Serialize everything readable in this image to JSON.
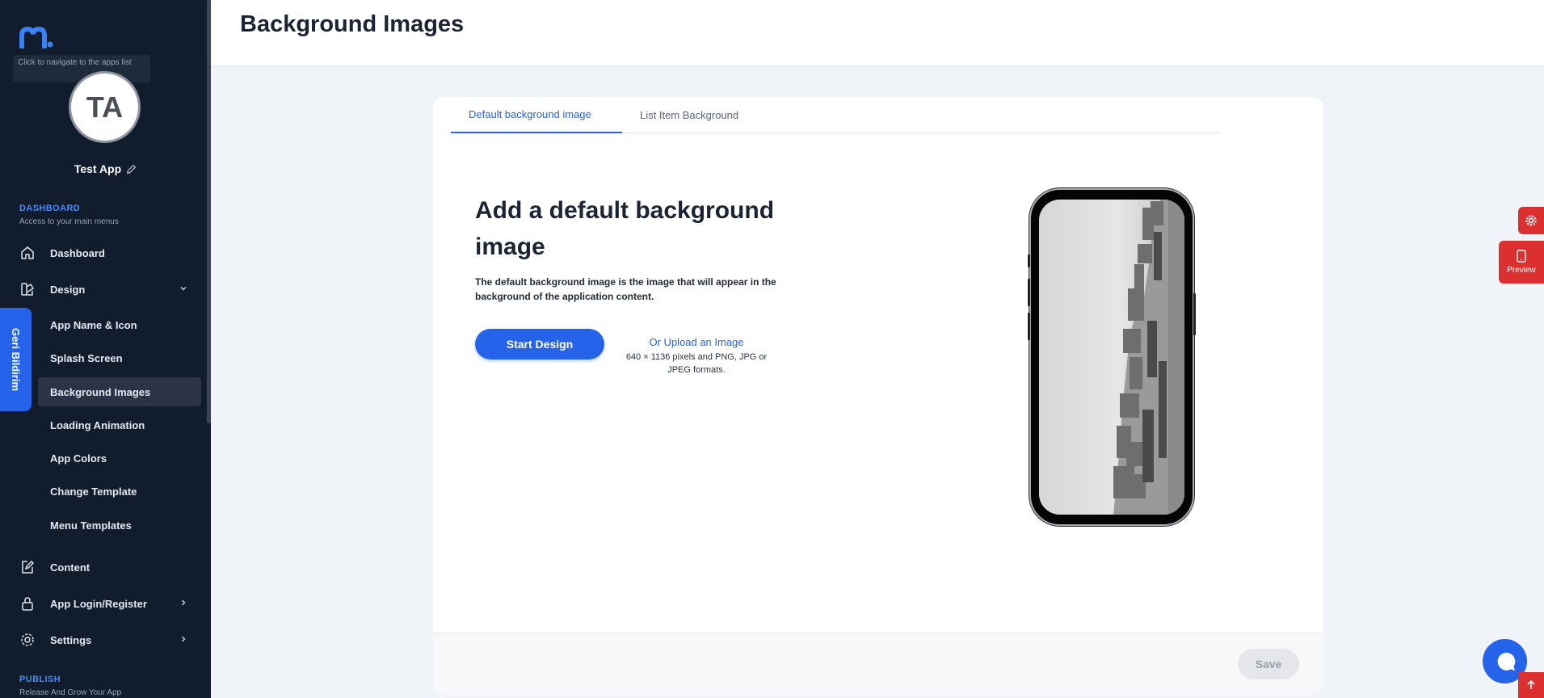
{
  "sidebar": {
    "tooltip": "Click to navigate to the apps list",
    "avatar_initials": "TA",
    "app_name": "Test App",
    "dashboard_section": {
      "title": "DASHBOARD",
      "subtitle": "Access to your main menus"
    },
    "nav": {
      "dashboard": "Dashboard",
      "design": "Design",
      "content": "Content",
      "login": "App Login/Register",
      "settings": "Settings"
    },
    "design_items": [
      "App Name & Icon",
      "Splash Screen",
      "Background Images",
      "Loading Animation",
      "App Colors",
      "Change Template",
      "Menu Templates"
    ],
    "active_item": "Background Images",
    "publish_section": {
      "title": "PUBLISH",
      "subtitle": "Release And Grow Your App"
    }
  },
  "feedback_tab": "Geri Bildirim",
  "page_title": "Background Images",
  "tabs": [
    "Default background image",
    "List Item Background"
  ],
  "active_tab": "Default background image",
  "main": {
    "heading": "Add a default background image",
    "description": "The default background image is the image that will appear in the background of the application content.",
    "start_button": "Start Design",
    "upload_link": "Or Upload an Image",
    "upload_note": "640 × 1136 pixels and PNG, JPG or JPEG formats."
  },
  "footer": {
    "save_button": "Save"
  },
  "floating": {
    "preview_label": "Preview"
  },
  "colors": {
    "sidebar_bg": "#111c2d",
    "accent": "#2563eb",
    "danger": "#dc2f2f",
    "page_bg": "#f0f3f8"
  }
}
